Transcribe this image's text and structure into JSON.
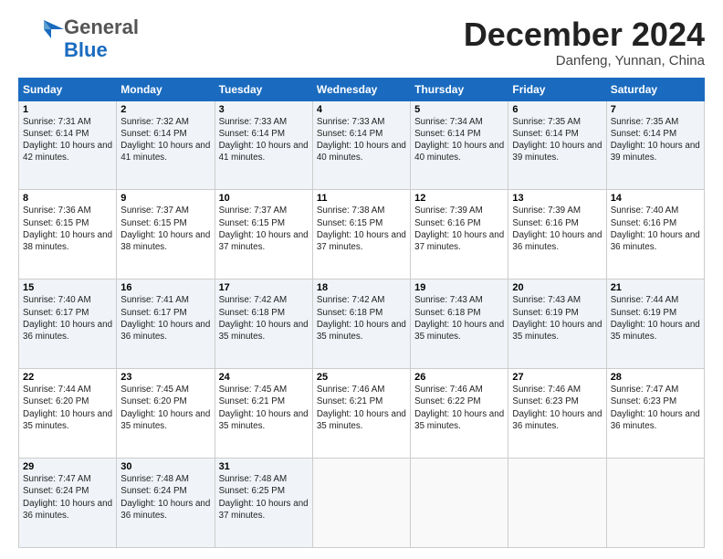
{
  "logo": {
    "general": "General",
    "blue": "Blue"
  },
  "title": "December 2024",
  "location": "Danfeng, Yunnan, China",
  "days_of_week": [
    "Sunday",
    "Monday",
    "Tuesday",
    "Wednesday",
    "Thursday",
    "Friday",
    "Saturday"
  ],
  "weeks": [
    [
      {
        "num": "1",
        "sunrise": "Sunrise: 7:31 AM",
        "sunset": "Sunset: 6:14 PM",
        "daylight": "Daylight: 10 hours and 42 minutes."
      },
      {
        "num": "2",
        "sunrise": "Sunrise: 7:32 AM",
        "sunset": "Sunset: 6:14 PM",
        "daylight": "Daylight: 10 hours and 41 minutes."
      },
      {
        "num": "3",
        "sunrise": "Sunrise: 7:33 AM",
        "sunset": "Sunset: 6:14 PM",
        "daylight": "Daylight: 10 hours and 41 minutes."
      },
      {
        "num": "4",
        "sunrise": "Sunrise: 7:33 AM",
        "sunset": "Sunset: 6:14 PM",
        "daylight": "Daylight: 10 hours and 40 minutes."
      },
      {
        "num": "5",
        "sunrise": "Sunrise: 7:34 AM",
        "sunset": "Sunset: 6:14 PM",
        "daylight": "Daylight: 10 hours and 40 minutes."
      },
      {
        "num": "6",
        "sunrise": "Sunrise: 7:35 AM",
        "sunset": "Sunset: 6:14 PM",
        "daylight": "Daylight: 10 hours and 39 minutes."
      },
      {
        "num": "7",
        "sunrise": "Sunrise: 7:35 AM",
        "sunset": "Sunset: 6:14 PM",
        "daylight": "Daylight: 10 hours and 39 minutes."
      }
    ],
    [
      {
        "num": "8",
        "sunrise": "Sunrise: 7:36 AM",
        "sunset": "Sunset: 6:15 PM",
        "daylight": "Daylight: 10 hours and 38 minutes."
      },
      {
        "num": "9",
        "sunrise": "Sunrise: 7:37 AM",
        "sunset": "Sunset: 6:15 PM",
        "daylight": "Daylight: 10 hours and 38 minutes."
      },
      {
        "num": "10",
        "sunrise": "Sunrise: 7:37 AM",
        "sunset": "Sunset: 6:15 PM",
        "daylight": "Daylight: 10 hours and 37 minutes."
      },
      {
        "num": "11",
        "sunrise": "Sunrise: 7:38 AM",
        "sunset": "Sunset: 6:15 PM",
        "daylight": "Daylight: 10 hours and 37 minutes."
      },
      {
        "num": "12",
        "sunrise": "Sunrise: 7:39 AM",
        "sunset": "Sunset: 6:16 PM",
        "daylight": "Daylight: 10 hours and 37 minutes."
      },
      {
        "num": "13",
        "sunrise": "Sunrise: 7:39 AM",
        "sunset": "Sunset: 6:16 PM",
        "daylight": "Daylight: 10 hours and 36 minutes."
      },
      {
        "num": "14",
        "sunrise": "Sunrise: 7:40 AM",
        "sunset": "Sunset: 6:16 PM",
        "daylight": "Daylight: 10 hours and 36 minutes."
      }
    ],
    [
      {
        "num": "15",
        "sunrise": "Sunrise: 7:40 AM",
        "sunset": "Sunset: 6:17 PM",
        "daylight": "Daylight: 10 hours and 36 minutes."
      },
      {
        "num": "16",
        "sunrise": "Sunrise: 7:41 AM",
        "sunset": "Sunset: 6:17 PM",
        "daylight": "Daylight: 10 hours and 36 minutes."
      },
      {
        "num": "17",
        "sunrise": "Sunrise: 7:42 AM",
        "sunset": "Sunset: 6:18 PM",
        "daylight": "Daylight: 10 hours and 35 minutes."
      },
      {
        "num": "18",
        "sunrise": "Sunrise: 7:42 AM",
        "sunset": "Sunset: 6:18 PM",
        "daylight": "Daylight: 10 hours and 35 minutes."
      },
      {
        "num": "19",
        "sunrise": "Sunrise: 7:43 AM",
        "sunset": "Sunset: 6:18 PM",
        "daylight": "Daylight: 10 hours and 35 minutes."
      },
      {
        "num": "20",
        "sunrise": "Sunrise: 7:43 AM",
        "sunset": "Sunset: 6:19 PM",
        "daylight": "Daylight: 10 hours and 35 minutes."
      },
      {
        "num": "21",
        "sunrise": "Sunrise: 7:44 AM",
        "sunset": "Sunset: 6:19 PM",
        "daylight": "Daylight: 10 hours and 35 minutes."
      }
    ],
    [
      {
        "num": "22",
        "sunrise": "Sunrise: 7:44 AM",
        "sunset": "Sunset: 6:20 PM",
        "daylight": "Daylight: 10 hours and 35 minutes."
      },
      {
        "num": "23",
        "sunrise": "Sunrise: 7:45 AM",
        "sunset": "Sunset: 6:20 PM",
        "daylight": "Daylight: 10 hours and 35 minutes."
      },
      {
        "num": "24",
        "sunrise": "Sunrise: 7:45 AM",
        "sunset": "Sunset: 6:21 PM",
        "daylight": "Daylight: 10 hours and 35 minutes."
      },
      {
        "num": "25",
        "sunrise": "Sunrise: 7:46 AM",
        "sunset": "Sunset: 6:21 PM",
        "daylight": "Daylight: 10 hours and 35 minutes."
      },
      {
        "num": "26",
        "sunrise": "Sunrise: 7:46 AM",
        "sunset": "Sunset: 6:22 PM",
        "daylight": "Daylight: 10 hours and 35 minutes."
      },
      {
        "num": "27",
        "sunrise": "Sunrise: 7:46 AM",
        "sunset": "Sunset: 6:23 PM",
        "daylight": "Daylight: 10 hours and 36 minutes."
      },
      {
        "num": "28",
        "sunrise": "Sunrise: 7:47 AM",
        "sunset": "Sunset: 6:23 PM",
        "daylight": "Daylight: 10 hours and 36 minutes."
      }
    ],
    [
      {
        "num": "29",
        "sunrise": "Sunrise: 7:47 AM",
        "sunset": "Sunset: 6:24 PM",
        "daylight": "Daylight: 10 hours and 36 minutes."
      },
      {
        "num": "30",
        "sunrise": "Sunrise: 7:48 AM",
        "sunset": "Sunset: 6:24 PM",
        "daylight": "Daylight: 10 hours and 36 minutes."
      },
      {
        "num": "31",
        "sunrise": "Sunrise: 7:48 AM",
        "sunset": "Sunset: 6:25 PM",
        "daylight": "Daylight: 10 hours and 37 minutes."
      },
      null,
      null,
      null,
      null
    ]
  ]
}
